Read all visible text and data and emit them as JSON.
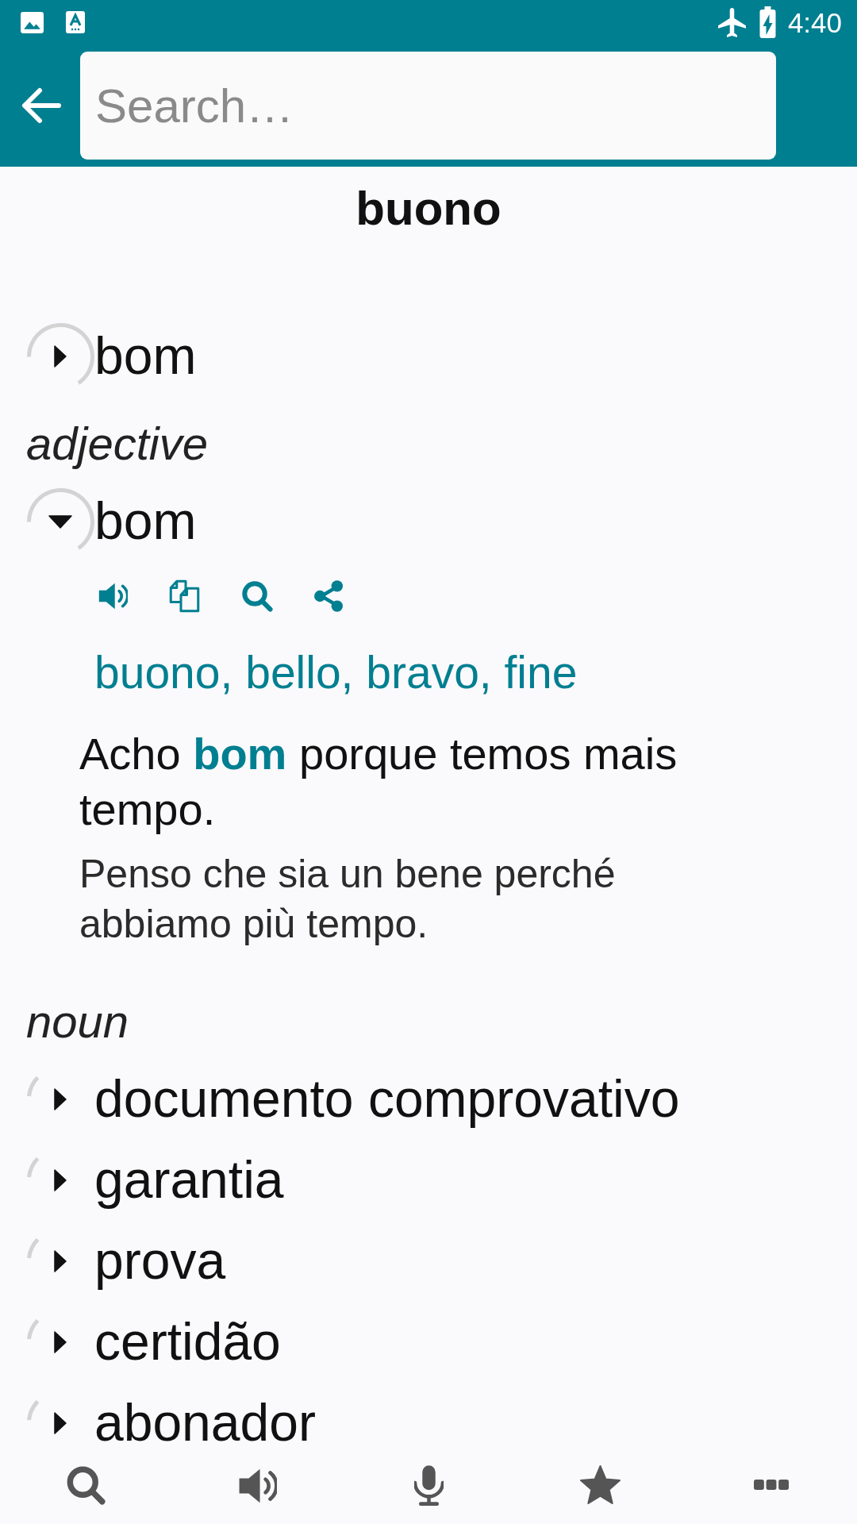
{
  "status_bar": {
    "time": "4:40"
  },
  "search": {
    "placeholder": "Search…"
  },
  "headword": "buono",
  "entries": [
    {
      "word": "bom",
      "expanded": false,
      "loading": true
    }
  ],
  "sections": [
    {
      "part_of_speech": "adjective",
      "entries": [
        {
          "word": "bom",
          "expanded": true,
          "loading": true,
          "translations": "buono, bello, bravo, fine",
          "examples": [
            {
              "text": "Acho **bom** porque temos mais tempo.",
              "translation": "Penso che sia un bene perché abbiamo più tempo."
            }
          ]
        }
      ]
    },
    {
      "part_of_speech": "noun",
      "entries": [
        {
          "word": "documento comprovativo",
          "expanded": false,
          "loading": true
        },
        {
          "word": "garantia",
          "expanded": false,
          "loading": true
        },
        {
          "word": "prova",
          "expanded": false,
          "loading": true
        },
        {
          "word": "certidão",
          "expanded": false,
          "loading": true
        },
        {
          "word": "abonador",
          "expanded": false,
          "loading": true
        }
      ]
    }
  ]
}
